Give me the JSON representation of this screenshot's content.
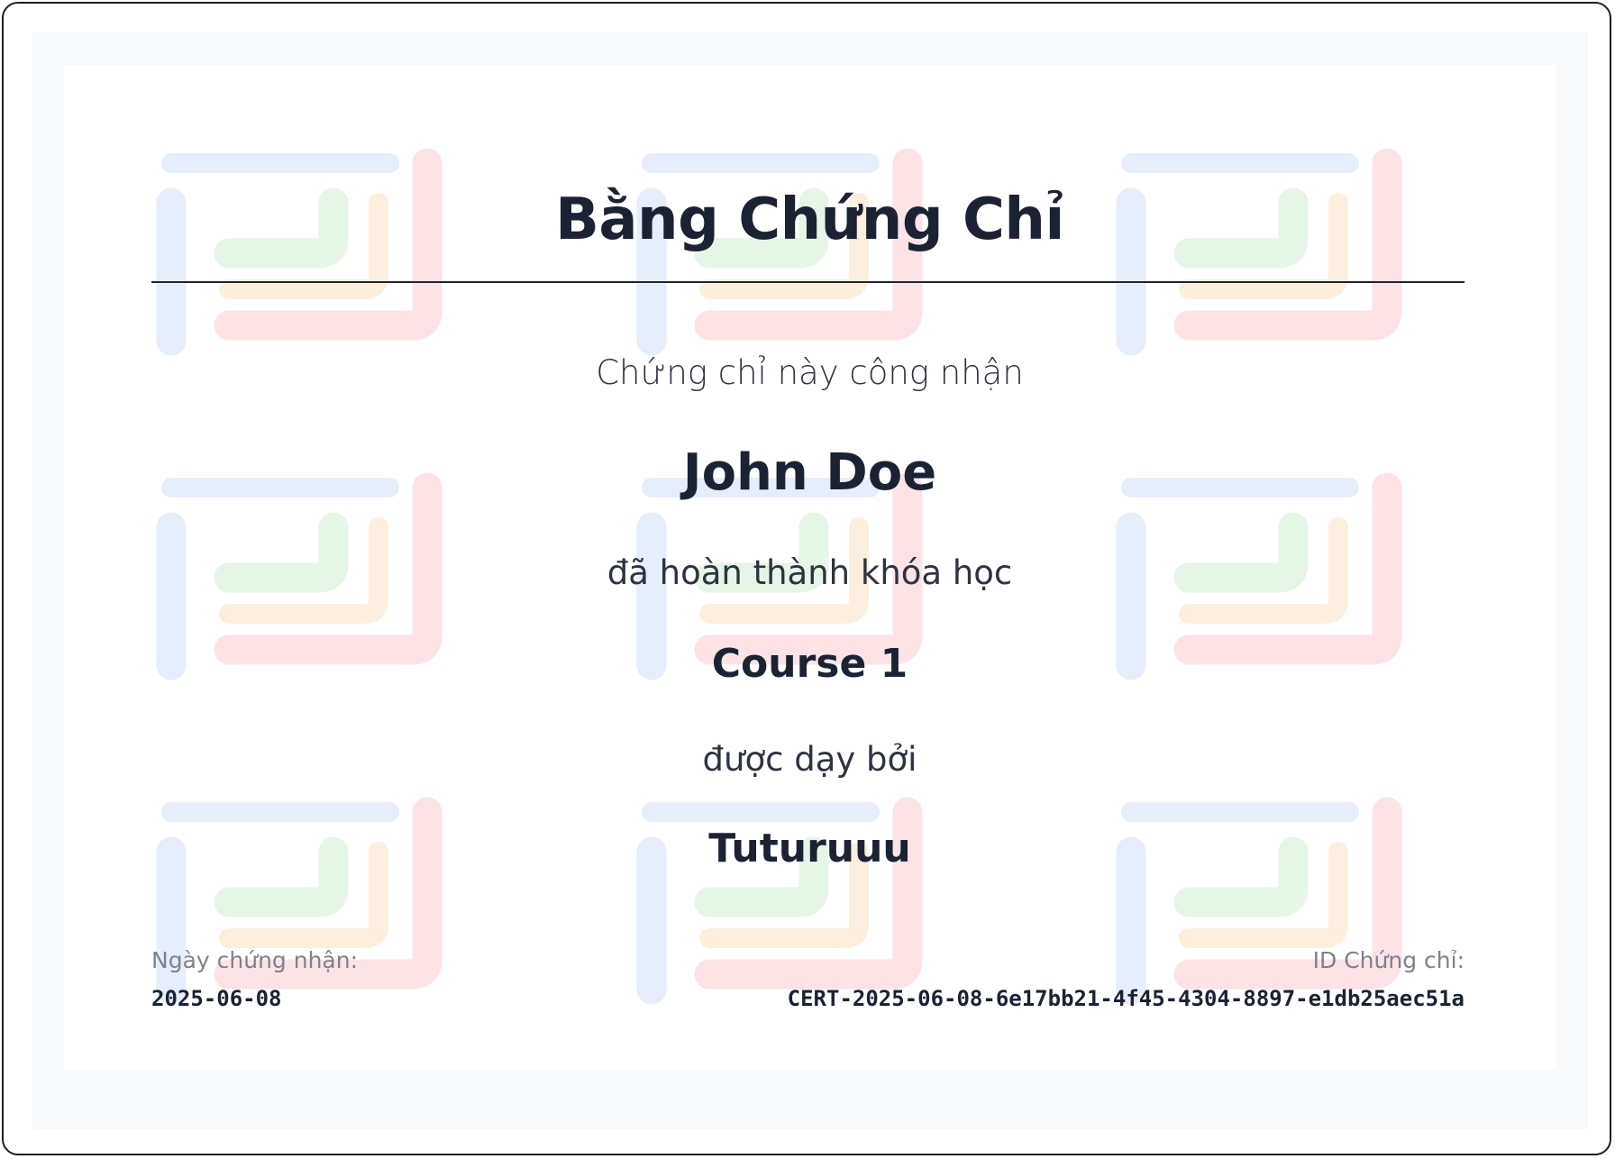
{
  "certificate": {
    "title": "Bằng Chứng Chỉ",
    "intro_text": "Chứng chỉ này công nhận",
    "recipient_name": "John Doe",
    "completed_text": "đã hoàn thành khóa học",
    "course_name": "Course 1",
    "taught_by_text": "được dạy bởi",
    "instructor_name": "Tuturuuu"
  },
  "footer": {
    "date_label": "Ngày chứng nhận:",
    "date_value": "2025-06-08",
    "id_label": "ID Chứng chỉ:",
    "id_value": "CERT-2025-06-08-6e17bb21-4f45-4304-8897-e1db25aec51a"
  },
  "watermark": {
    "icon": "logo-watermark-icon",
    "colors": {
      "blue": "#e6edfb",
      "green": "#e5f6e6",
      "orange": "#feeede",
      "red": "#fde3e5"
    }
  },
  "colors": {
    "text_dark": "#1a2233",
    "text_muted": "#7d828c",
    "page_bg": "#f8f9fb",
    "card_bg": "#ffffff",
    "border": "#1b1e24"
  }
}
